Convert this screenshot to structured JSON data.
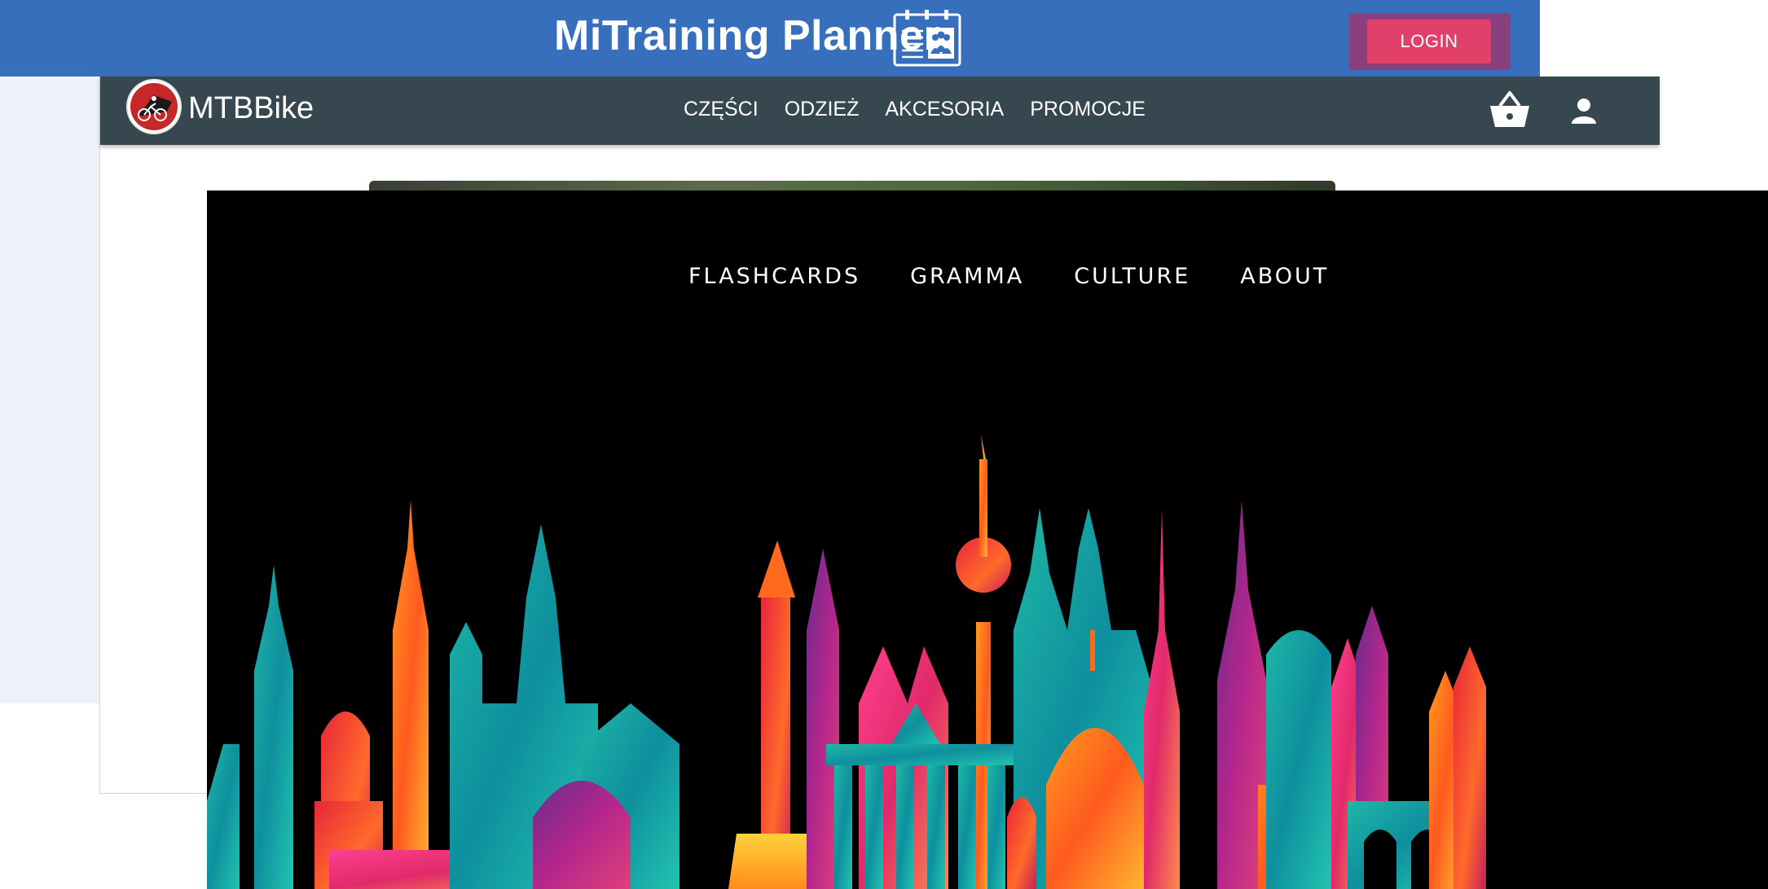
{
  "planner": {
    "title": "MiTraining Planner",
    "icon": "calendar-team-icon",
    "login_label": "LOGIN",
    "colors": {
      "header": "#376fbd",
      "login_button": "#e0406a",
      "login_frame": "#8a3f7f",
      "body": "#eef2f8"
    }
  },
  "shop": {
    "brand": "MTBBike",
    "logo_icon": "bike-logo-icon",
    "menu": [
      {
        "label": "CZĘŚCI"
      },
      {
        "label": "ODZIEŻ"
      },
      {
        "label": "AKCESORIA"
      },
      {
        "label": "PROMOCJE"
      }
    ],
    "cart_icon": "basket-icon",
    "account_icon": "person-icon",
    "colors": {
      "navbar": "#37474f"
    }
  },
  "language_site": {
    "nav": [
      {
        "label": "FLASHCARDS"
      },
      {
        "label": "GRAMMA"
      },
      {
        "label": "CULTURE"
      },
      {
        "label": "ABOUT"
      }
    ],
    "hero_image": "colorful-city-skyline-illustration",
    "colors": {
      "background": "#000000",
      "nav_text": "#ffffff"
    }
  }
}
